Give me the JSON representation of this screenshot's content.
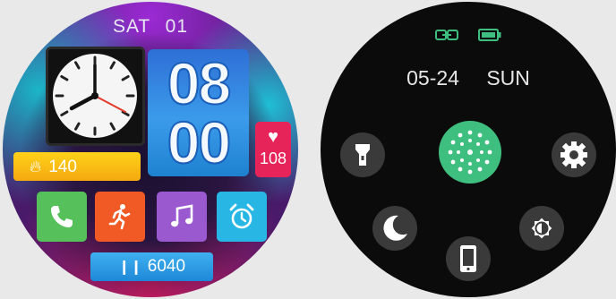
{
  "left_watch": {
    "day_label": "SAT  01",
    "digital_time": {
      "hours": "08",
      "minutes": "00"
    },
    "heart_rate": {
      "value": "108",
      "icon": "heart-icon",
      "color": "#e6245a"
    },
    "calories": {
      "value": "140",
      "icon": "flame-icon",
      "color": "#f4b21a"
    },
    "steps": {
      "value": "6040",
      "icon": "footprints-icon",
      "color": "#2b9ae6"
    },
    "apps": [
      {
        "name": "phone",
        "icon": "phone-icon",
        "color": "#56c15a"
      },
      {
        "name": "workout",
        "icon": "running-icon",
        "color": "#f15a24"
      },
      {
        "name": "music",
        "icon": "music-note-icon",
        "color": "#9b59d0"
      },
      {
        "name": "alarm",
        "icon": "alarm-clock-icon",
        "color": "#28b7e4"
      }
    ]
  },
  "right_watch": {
    "status_icons": [
      "link-icon",
      "battery-icon"
    ],
    "date": "05-24",
    "weekday": "SUN",
    "accent_color": "#3fbf7f",
    "quick_buttons": [
      {
        "name": "flashlight",
        "icon": "flashlight-icon"
      },
      {
        "name": "center",
        "icon": "dotted-circle-icon"
      },
      {
        "name": "settings",
        "icon": "gear-icon"
      },
      {
        "name": "do-not-disturb",
        "icon": "moon-icon"
      },
      {
        "name": "brightness",
        "icon": "brightness-icon"
      },
      {
        "name": "find-phone",
        "icon": "phone-device-icon"
      }
    ]
  }
}
